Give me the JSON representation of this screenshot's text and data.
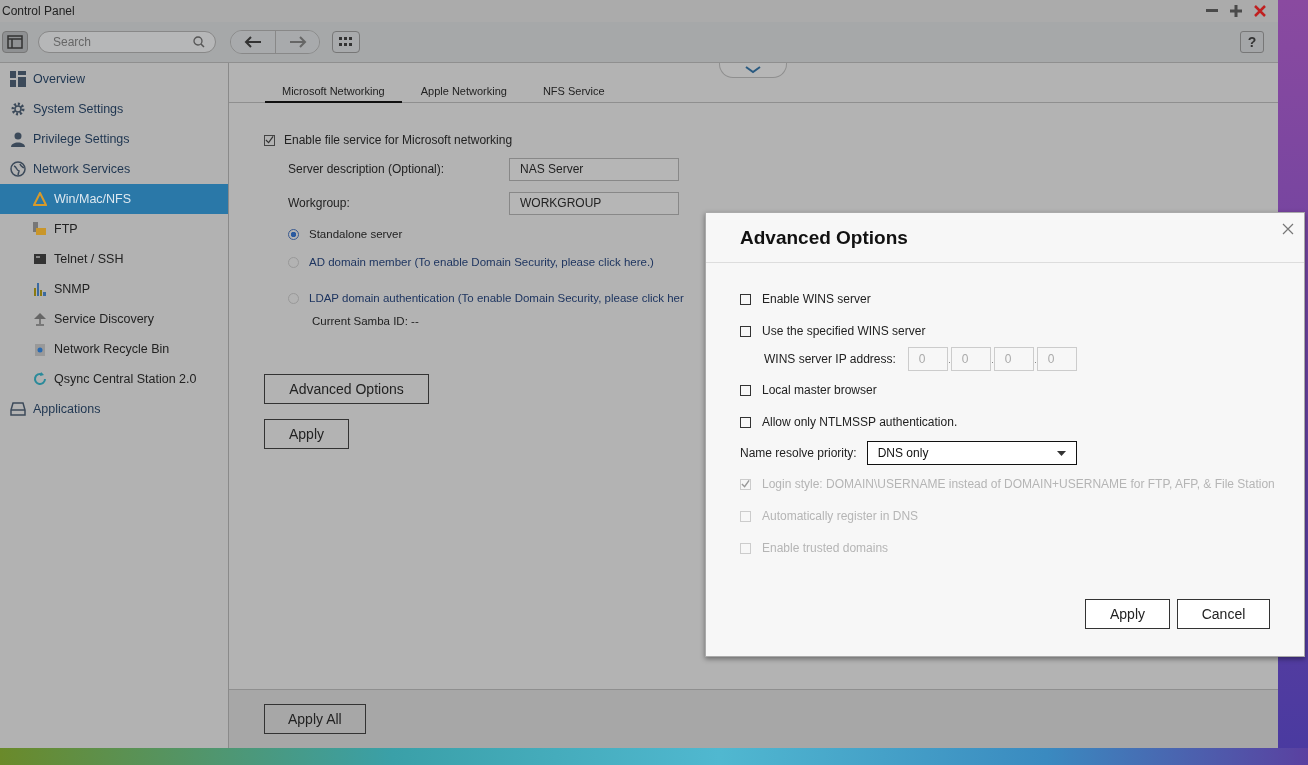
{
  "window": {
    "title": "Control Panel"
  },
  "toolbar": {
    "search": {
      "placeholder": "Search"
    },
    "help": "?"
  },
  "sidebar": {
    "items": [
      {
        "label": "Overview",
        "selected": false
      },
      {
        "label": "System Settings",
        "selected": false
      },
      {
        "label": "Privilege Settings",
        "selected": false
      },
      {
        "label": "Network Services",
        "selected": false,
        "children": [
          {
            "label": "Win/Mac/NFS",
            "selected": true
          },
          {
            "label": "FTP",
            "selected": false
          },
          {
            "label": "Telnet / SSH",
            "selected": false
          },
          {
            "label": "SNMP",
            "selected": false
          },
          {
            "label": "Service Discovery",
            "selected": false
          },
          {
            "label": "Network Recycle Bin",
            "selected": false
          },
          {
            "label": "Qsync Central Station 2.0",
            "selected": false
          }
        ]
      },
      {
        "label": "Applications",
        "selected": false
      }
    ]
  },
  "tabs": [
    {
      "label": "Microsoft Networking",
      "selected": true
    },
    {
      "label": "Apple Networking",
      "selected": false
    },
    {
      "label": "NFS Service",
      "selected": false
    }
  ],
  "form": {
    "enable": {
      "label": "Enable file service for Microsoft networking",
      "checked": true
    },
    "fields": [
      {
        "label": "Server description (Optional):",
        "value": "NAS Server"
      },
      {
        "label": "Workgroup:",
        "value": "WORKGROUP"
      }
    ],
    "radios": [
      {
        "label": "Standalone server",
        "selected": true,
        "link": false
      },
      {
        "label": "AD domain member (To enable Domain Security, please click here.)",
        "selected": false,
        "link": true
      },
      {
        "label": "LDAP domain authentication (To enable Domain Security, please click her",
        "selected": false,
        "link": true
      }
    ],
    "samba_id": "Current Samba ID: --",
    "buttons": [
      "Advanced Options",
      "Apply"
    ]
  },
  "footer": {
    "button": "Apply All"
  },
  "dialog": {
    "title": "Advanced Options",
    "rows": [
      {
        "kind": "checkbox",
        "label": "Enable WINS server",
        "checked": false,
        "disabled": false
      },
      {
        "kind": "checkbox",
        "label": "Use the specified WINS server",
        "checked": false,
        "disabled": false
      },
      {
        "kind": "ip",
        "label": "WINS server IP address:",
        "octets": [
          "0",
          "0",
          "0",
          "0"
        ]
      },
      {
        "kind": "checkbox",
        "label": "Local master browser",
        "checked": false,
        "disabled": false
      },
      {
        "kind": "checkbox",
        "label": "Allow only NTLMSSP authentication.",
        "checked": false,
        "disabled": false
      },
      {
        "kind": "select",
        "label": "Name resolve priority:",
        "value": "DNS only"
      },
      {
        "kind": "checkbox",
        "label": "Login style: DOMAIN\\USERNAME instead of DOMAIN+USERNAME for FTP, AFP, & File Station",
        "checked": true,
        "disabled": true
      },
      {
        "kind": "checkbox",
        "label": "Automatically register in DNS",
        "checked": false,
        "disabled": true
      },
      {
        "kind": "checkbox",
        "label": "Enable trusted domains",
        "checked": false,
        "disabled": true
      }
    ],
    "buttons": [
      "Apply",
      "Cancel"
    ]
  }
}
